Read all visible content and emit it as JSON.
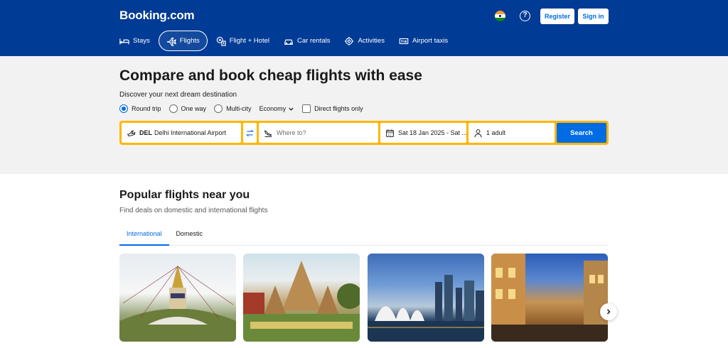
{
  "header": {
    "logo": "Booking.com",
    "register_label": "Register",
    "signin_label": "Sign in",
    "help_glyph": "?",
    "nav": [
      {
        "label": "Stays",
        "icon": "bed-icon"
      },
      {
        "label": "Flights",
        "icon": "plane-icon",
        "active": true
      },
      {
        "label": "Flight + Hotel",
        "icon": "flight-hotel-icon"
      },
      {
        "label": "Car rentals",
        "icon": "car-icon"
      },
      {
        "label": "Activities",
        "icon": "activities-icon"
      },
      {
        "label": "Airport taxis",
        "icon": "taxi-icon"
      }
    ]
  },
  "hero": {
    "title": "Compare and book cheap flights with ease",
    "subtitle": "Discover your next dream destination",
    "trip_types": [
      "Round trip",
      "One way",
      "Multi-city"
    ],
    "selected_trip_type": "Round trip",
    "cabin_class": "Economy",
    "direct_flights_label": "Direct flights only",
    "direct_flights_checked": false
  },
  "search": {
    "from_code": "DEL",
    "from_name": "Delhi International Airport",
    "to_placeholder": "Where to?",
    "dates": "Sat 18 Jan 2025 - Sat ...",
    "travellers": "1 adult",
    "button_label": "Search"
  },
  "popular": {
    "title": "Popular flights near you",
    "subtitle": "Find deals on domestic and international flights",
    "tabs": [
      "International",
      "Domestic"
    ],
    "active_tab": "International"
  },
  "colors": {
    "brand_blue": "#003b95",
    "action_blue": "#006ce4",
    "search_yellow": "#ffb700"
  }
}
